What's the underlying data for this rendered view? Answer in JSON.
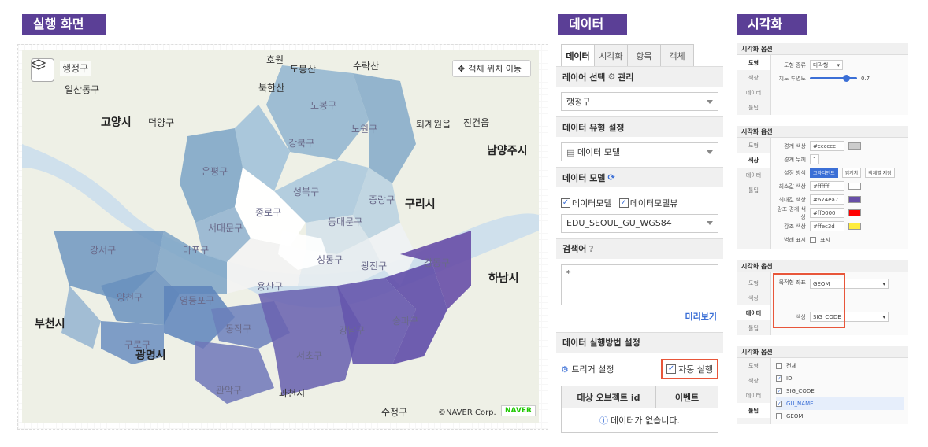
{
  "tags": {
    "run": "실행 화면",
    "data": "데이터",
    "vis": "시각화"
  },
  "map": {
    "layer_label": "행정구",
    "move_button": "객체 위치 이동",
    "copyright": "©NAVER Corp.",
    "logo": "NAVER",
    "labels": {
      "goyang": "고양시",
      "namyangju": "남양주시",
      "guri": "구리시",
      "hanam": "하남시",
      "bucheon": "부천시",
      "gwangmyeong": "광명시",
      "dobong": "도봉구",
      "nowon": "노원구",
      "gangbuk": "강북구",
      "eunpyeong": "은평구",
      "seongbuk": "성북구",
      "jungnang": "중랑구",
      "dongdaemun": "동대문구",
      "seodaemun": "서대문구",
      "mapo": "마포구",
      "gangseo": "강서구",
      "yangcheon": "양천구",
      "guro": "구로구",
      "yeongdeungpo": "영등포구",
      "dongjak": "동작구",
      "gwanak": "관악구",
      "seocho": "서초구",
      "gangnam": "강남구",
      "songpa": "송파구",
      "gangdong": "강동구",
      "gwangjin": "광진구",
      "seongdong": "성동구",
      "yongsan": "용산구",
      "jongno": "종로구",
      "gwacheon": "과천시",
      "deogyang": "덕양구",
      "ilsandong": "일산동구",
      "jinggwanggeon": "진건읍",
      "toegyewon": "퇴계원읍",
      "bukhansan": "북한산",
      "dobongsan": "도봉산",
      "suraksan": "수락산",
      "hoho": "호원",
      "sujeong": "수정구"
    }
  },
  "data_panel": {
    "tabs": [
      "데이터",
      "시각화",
      "항목",
      "객체"
    ],
    "layer_select_title": "레이어 선택",
    "layer_manage": "관리",
    "layer_value": "행정구",
    "data_type_title": "데이터 유형 설정",
    "data_type_value": "데이터 모델",
    "data_model_title": "데이터 모델",
    "chk_model": "데이터모델",
    "chk_model_view": "데이터모델뷰",
    "model_value": "EDU_SEOUL_GU_WGS84",
    "search_title": "검색어",
    "search_value": "*",
    "preview": "미리보기",
    "exec_title": "데이터 실행방법 설정",
    "trigger": "트리거 설정",
    "auto_run": "자동 실행",
    "col_target": "대상 오브젝트 id",
    "col_event": "이벤트",
    "empty": "데이터가 없습니다."
  },
  "vis_panel": {
    "box1": {
      "title": "시각화 옵션",
      "side": [
        "도형",
        "색상",
        "데이터",
        "툴팁"
      ],
      "shape_type_label": "도형 종류",
      "shape_type_value": "다각형",
      "opacity_label": "지도 투명도",
      "opacity_value": "0.7",
      "opacity_fraction": 0.7
    },
    "box2": {
      "title": "시각화 옵션",
      "side": [
        "도형",
        "색상",
        "데이터",
        "툴팁"
      ],
      "border_color_label": "경계 색상",
      "border_color_value": "#cccccc",
      "border_width_label": "경계 두께",
      "border_width_value": "1",
      "mode_label": "설정 방식",
      "modes": [
        "그라디언트",
        "임계치",
        "객체별 지정"
      ],
      "min_label": "최소값 색상",
      "min_value": "#ffffff",
      "max_label": "최대값 색상",
      "max_value": "#674ea7",
      "hl_label": "강조 경계 색상",
      "hl_value": "#ff0000",
      "emph_label": "강조 색상",
      "emph_value": "#ffec3d",
      "legend_label": "범례 표시",
      "legend_value": "표시"
    },
    "box3": {
      "title": "시각화 옵션",
      "side": [
        "도형",
        "색상",
        "데이터",
        "툴팁"
      ],
      "geo_label": "목적형 좌표",
      "geo_value": "GEOM",
      "color_label": "색상",
      "color_value": "SIG_CODE"
    },
    "box4": {
      "title": "시각화 옵션",
      "side": [
        "도형",
        "색상",
        "데이터",
        "툴팁"
      ],
      "all": "전체",
      "fields": [
        "ID",
        "SIG_CODE",
        "GU_NAME",
        "GEOM"
      ]
    }
  },
  "colors": {
    "accent": "#5b3f96",
    "highlight_box": "#e8563a",
    "link": "#3b6fd6"
  }
}
